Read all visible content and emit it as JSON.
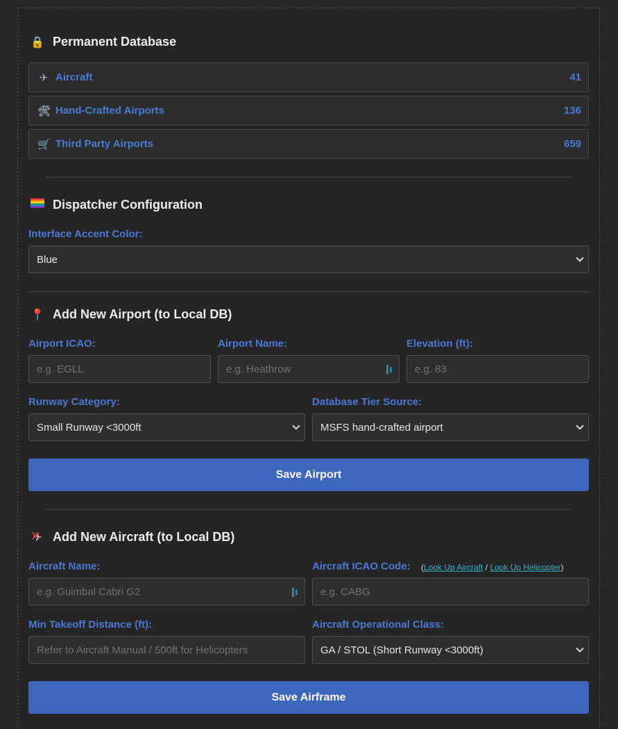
{
  "permanent_db": {
    "title": "Permanent Database",
    "title_icon": "lock-icon",
    "rows": [
      {
        "icon": "airplane-icon",
        "label": "Aircraft",
        "count": "41"
      },
      {
        "icon": "tools-icon",
        "label": "Hand-Crafted Airports",
        "count": "136"
      },
      {
        "icon": "cart-icon",
        "label": "Third Party Airports",
        "count": "659"
      }
    ]
  },
  "dispatcher": {
    "title": "Dispatcher Configuration",
    "title_icon": "rainbow-flag-icon",
    "accent_label": "Interface Accent Color:",
    "accent_value": "Blue"
  },
  "add_airport": {
    "title": "Add New Airport (to Local DB)",
    "title_icon": "pushpin-icon",
    "icao_label": "Airport ICAO:",
    "icao_placeholder": "e.g. EGLL",
    "name_label": "Airport Name:",
    "name_placeholder": "e.g. Heathrow",
    "elev_label": "Elevation (ft):",
    "elev_placeholder": "e.g. 83",
    "runway_label": "Runway Category:",
    "runway_value": "Small Runway <3000ft",
    "tier_label": "Database Tier Source:",
    "tier_value": "MSFS hand-crafted airport",
    "save_label": "Save Airport"
  },
  "add_aircraft": {
    "title": "Add New Aircraft (to Local DB)",
    "title_icon": "aircraft-crossed-icon",
    "name_label": "Aircraft Name:",
    "name_placeholder": "e.g. Guimbal Cabri G2",
    "icao_label": "Aircraft ICAO Code:",
    "lookup_aircraft": "Look Up Aircraft",
    "lookup_heli": "Look Up Helicopter",
    "icao_placeholder": "e.g. CABG",
    "takeoff_label": "Min Takeoff Distance (ft):",
    "takeoff_placeholder": "Refer to Aircraft Manual / 500ft for Helicopters",
    "class_label": "Aircraft Operational Class:",
    "class_value": "GA / STOL (Short Runway <3000ft)",
    "save_label": "Save Airframe"
  }
}
